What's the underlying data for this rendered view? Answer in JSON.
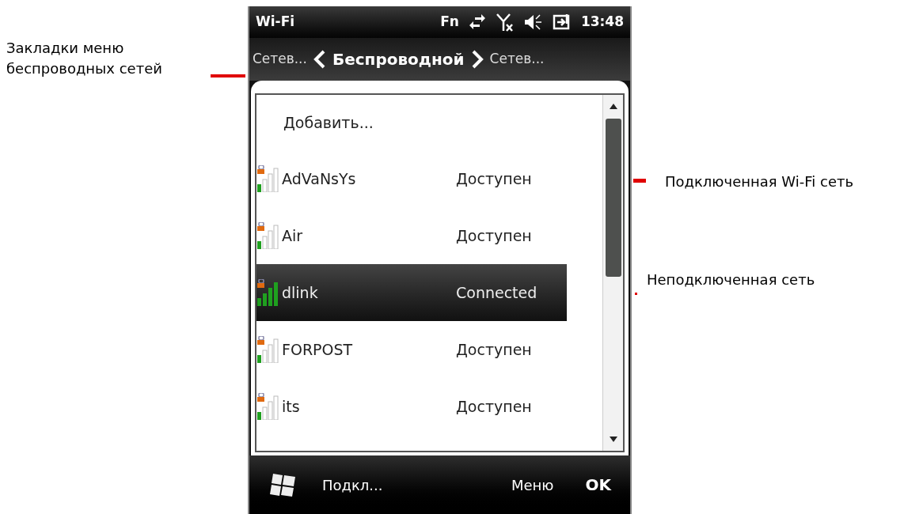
{
  "annotations": {
    "left": "Закладки меню беспроводных сетей",
    "right_top": "Подключенная Wi-Fi сеть",
    "right_bottom": "Неподключенная сеть"
  },
  "status_bar": {
    "title": "Wi-Fi",
    "fn": "Fn",
    "time": "13:48"
  },
  "tab_bar": {
    "prev": "Сетев...",
    "current": "Беспроводной",
    "next": "Сетев..."
  },
  "list": {
    "add": "Добавить...",
    "networks": [
      {
        "name": "AdVaNsYs",
        "status": "Доступен",
        "selected": false
      },
      {
        "name": "Air",
        "status": "Доступен",
        "selected": false
      },
      {
        "name": "dlink",
        "status": "Connected",
        "selected": true
      },
      {
        "name": "FORPOST",
        "status": "Доступен",
        "selected": false
      },
      {
        "name": "its",
        "status": "Доступен",
        "selected": false
      }
    ]
  },
  "soft_keys": {
    "left": "Подкл...",
    "menu": "Меню",
    "ok": "OK"
  }
}
